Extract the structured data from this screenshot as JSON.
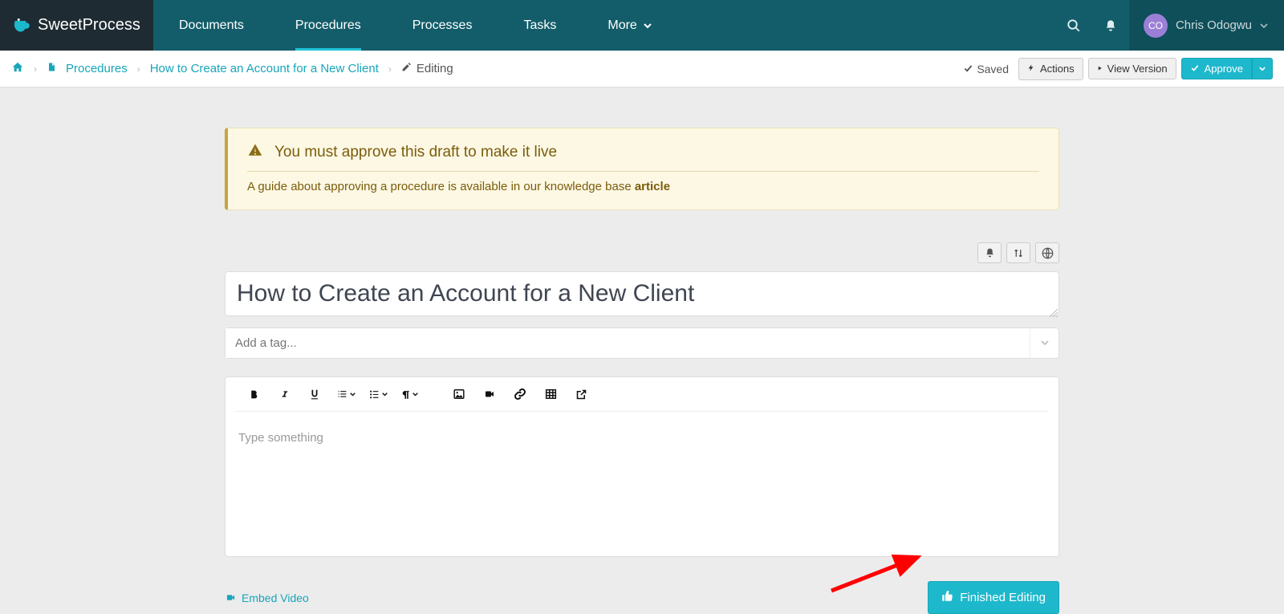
{
  "brand": {
    "name_bold": "Sweet",
    "name_light": "Process"
  },
  "nav": {
    "documents": "Documents",
    "procedures": "Procedures",
    "processes": "Processes",
    "tasks": "Tasks",
    "more": "More"
  },
  "user": {
    "initials": "CO",
    "name": "Chris Odogwu"
  },
  "breadcrumb": {
    "procedures": "Procedures",
    "doc_title": "How to Create an Account for a New Client",
    "editing": "Editing"
  },
  "subbar": {
    "saved": "Saved",
    "actions": "Actions",
    "view_version": "View Version",
    "approve": "Approve"
  },
  "alert": {
    "title": "You must approve this draft to make it live",
    "sub_prefix": "A guide about approving a procedure is available in our knowledge base ",
    "sub_link": "article"
  },
  "editor": {
    "title_value": "How to Create an Account for a New Client",
    "tag_placeholder": "Add a tag...",
    "body_placeholder": "Type something"
  },
  "bottom": {
    "embed_video": "Embed Video",
    "finished_editing": "Finished Editing"
  }
}
